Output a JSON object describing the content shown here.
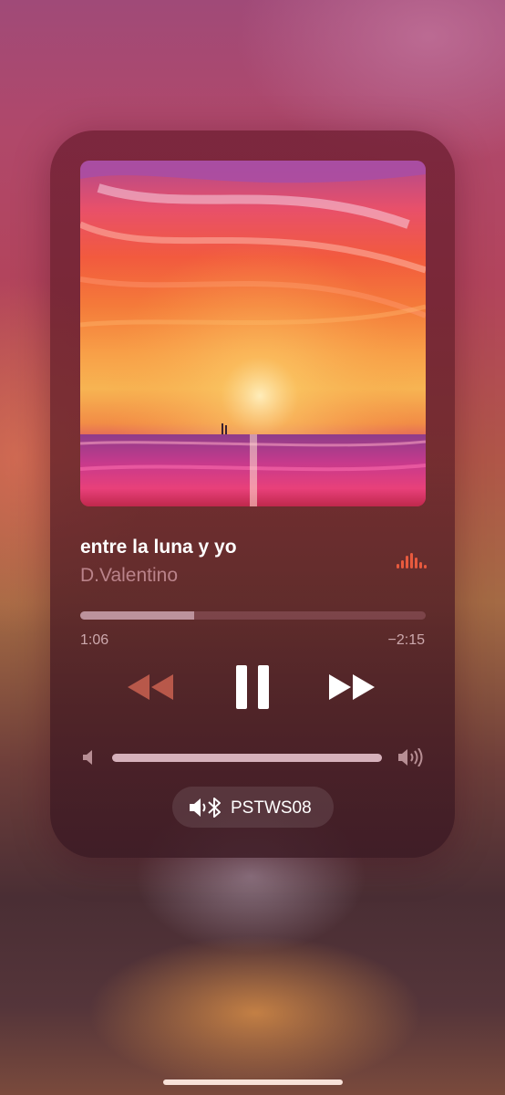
{
  "now_playing": {
    "title": "entre la luna y yo",
    "artist": "D.Valentino",
    "artwork": "sunset-ocean-painting",
    "playback_state": "playing",
    "progress_fraction": 0.33
  },
  "timeline": {
    "elapsed": "1:06",
    "remaining": "−2:15"
  },
  "controls": {
    "rewind": "rewind-icon",
    "pause": "pause-icon",
    "forward": "fast-forward-icon"
  },
  "volume": {
    "level_fraction": 1.0,
    "low_icon": "speaker-low-icon",
    "high_icon": "speaker-high-icon"
  },
  "output": {
    "device": "PSTWS08",
    "icon": "bluetooth-speaker-icon"
  },
  "colors": {
    "accent": "#e85a3e",
    "text_primary": "#ffffff"
  }
}
